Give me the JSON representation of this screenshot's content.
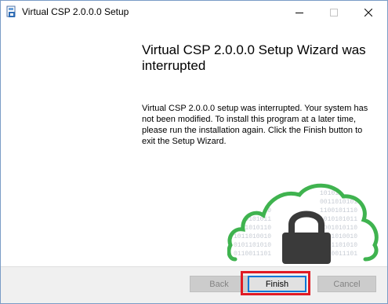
{
  "window": {
    "title": "Virtual CSP 2.0.0.0 Setup",
    "icons": {
      "app": "installer-icon",
      "minimize": "minimize-icon",
      "maximize": "maximize-icon",
      "close": "close-icon"
    }
  },
  "content": {
    "heading": "Virtual CSP 2.0.0.0 Setup Wizard was interrupted",
    "body": "Virtual CSP 2.0.0.0 setup was interrupted. Your system has not been modified. To install this program at a later time, please run the installation again. Click the Finish button to exit the Setup Wizard.",
    "art": {
      "icon": "cloud-lock-icon",
      "binary_lines": [
        "1010111010",
        "0011010101",
        "1100101110",
        "1010101011",
        "0001010110",
        "1011010010",
        "0101101010",
        "0110011101"
      ]
    }
  },
  "buttons": {
    "back": {
      "label": "Back",
      "enabled": false
    },
    "finish": {
      "label": "Finish",
      "enabled": true,
      "focused": true
    },
    "cancel": {
      "label": "Cancel",
      "enabled": false
    }
  },
  "colors": {
    "highlight": "#e01b24",
    "cloud": "#3fb34f",
    "lock": "#3a3a3a",
    "focus": "#0078d7"
  }
}
